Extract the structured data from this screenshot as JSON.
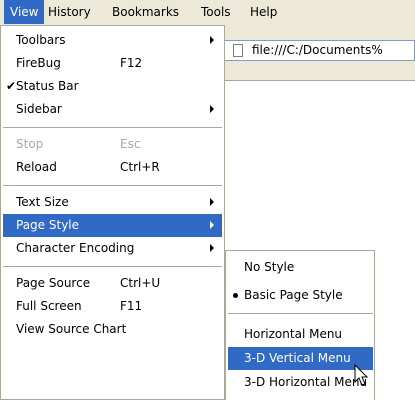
{
  "menubar": {
    "items": [
      {
        "label": "View",
        "active": true
      },
      {
        "label": "History"
      },
      {
        "label": "Bookmarks"
      },
      {
        "label": "Tools"
      },
      {
        "label": "Help"
      }
    ]
  },
  "address_bar": {
    "url": "file:///C:/Documents%"
  },
  "view_menu": {
    "toolbars": "Toolbars",
    "firebug": "FireBug",
    "firebug_shortcut": "F12",
    "status_bar": "Status Bar",
    "sidebar": "Sidebar",
    "stop": "Stop",
    "stop_shortcut": "Esc",
    "reload": "Reload",
    "reload_shortcut": "Ctrl+R",
    "text_size": "Text Size",
    "page_style": "Page Style",
    "character_encoding": "Character Encoding",
    "page_source": "Page Source",
    "page_source_shortcut": "Ctrl+U",
    "full_screen": "Full Screen",
    "full_screen_shortcut": "F11",
    "view_source_chart": "View Source Chart"
  },
  "page_style_submenu": {
    "no_style": "No Style",
    "basic_page_style": "Basic Page Style",
    "horizontal_menu": "Horizontal Menu",
    "vertical_3d_menu": "3-D Vertical Menu",
    "horizontal_3d_menu": "3-D Horizontal Menu"
  },
  "colors": {
    "highlight": "#316ac5",
    "menubar_bg": "#ece9d8",
    "disabled_text": "#aca899"
  },
  "icons": [
    "page-icon",
    "check-icon",
    "submenu-arrow-icon",
    "radio-dot-icon",
    "mouse-pointer-icon"
  ]
}
